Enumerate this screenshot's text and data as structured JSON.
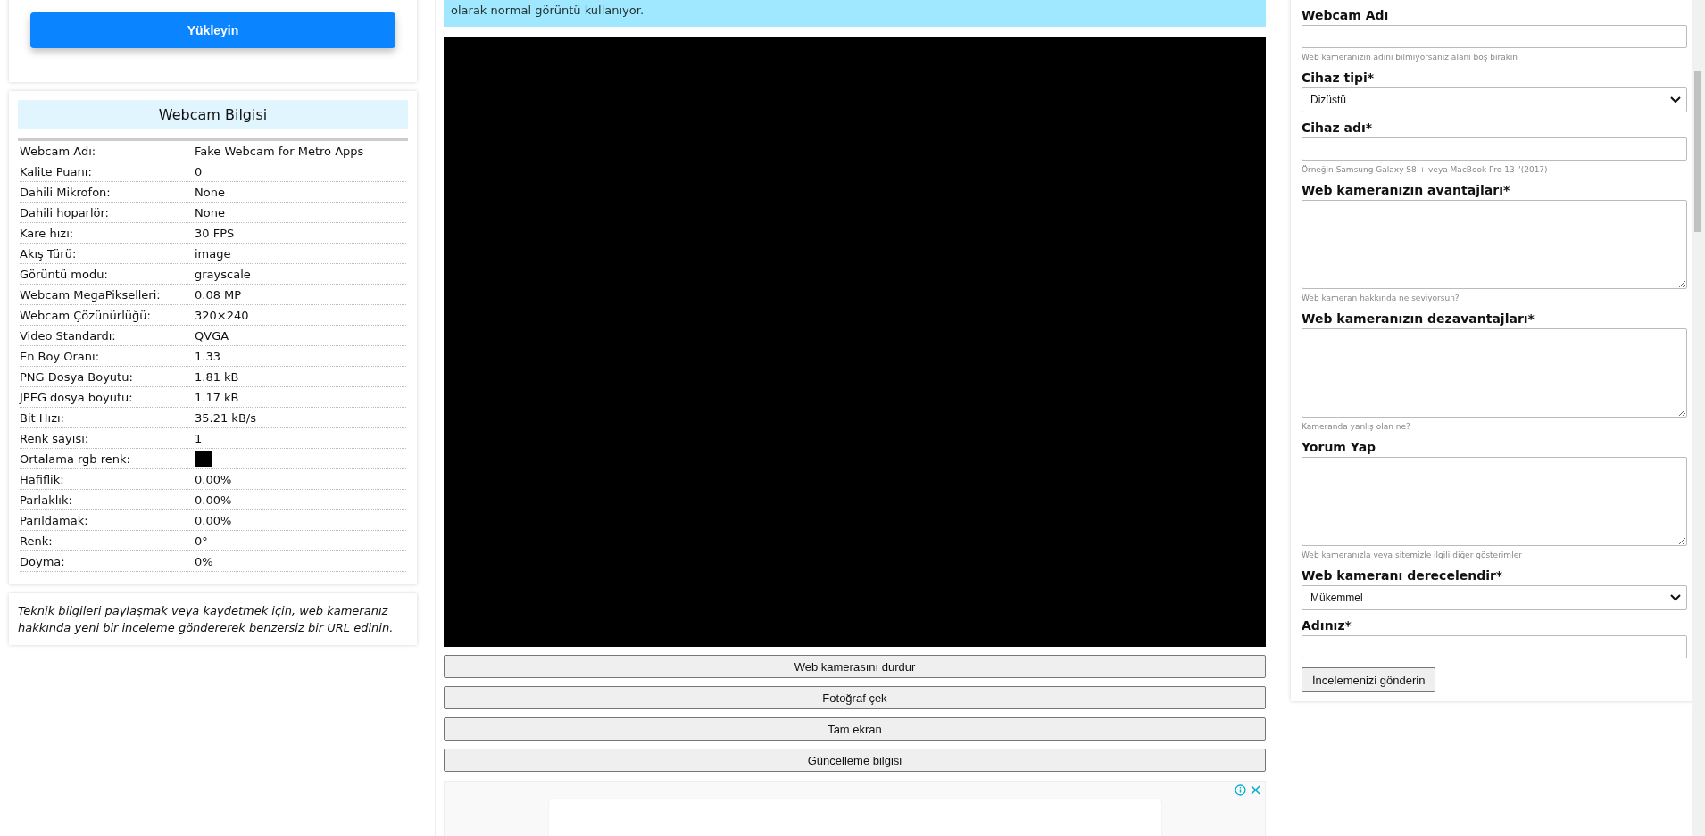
{
  "upload": {
    "button": "Yükleyin"
  },
  "info": {
    "title": "Webcam Bilgisi",
    "rows": [
      {
        "kind": "text",
        "label": "Webcam Adı:",
        "value": "Fake Webcam for Metro Apps"
      },
      {
        "kind": "text",
        "label": "Kalite Puanı:",
        "value": "0"
      },
      {
        "kind": "text",
        "label": "Dahili Mikrofon:",
        "value": "None"
      },
      {
        "kind": "text",
        "label": "Dahili hoparlör:",
        "value": "None"
      },
      {
        "kind": "text",
        "label": "Kare hızı:",
        "value": "30 FPS"
      },
      {
        "kind": "text",
        "label": "Akış Türü:",
        "value": "image"
      },
      {
        "kind": "text",
        "label": "Görüntü modu:",
        "value": "grayscale"
      },
      {
        "kind": "text",
        "label": "Webcam MegaPikselleri:",
        "value": "0.08 MP"
      },
      {
        "kind": "text",
        "label": "Webcam Çözünürlüğü:",
        "value": "320×240"
      },
      {
        "kind": "text",
        "label": "Video Standardı:",
        "value": "QVGA"
      },
      {
        "kind": "text",
        "label": "En Boy Oranı:",
        "value": "1.33"
      },
      {
        "kind": "text",
        "label": "PNG Dosya Boyutu:",
        "value": "1.81 kB"
      },
      {
        "kind": "text",
        "label": "JPEG dosya boyutu:",
        "value": "1.17 kB"
      },
      {
        "kind": "text",
        "label": "Bit Hızı:",
        "value": "35.21 kB/s"
      },
      {
        "kind": "text",
        "label": "Renk sayısı:",
        "value": "1"
      },
      {
        "kind": "swatch",
        "label": "Ortalama rgb renk:",
        "color": "#000000"
      },
      {
        "kind": "text",
        "label": "Hafiflik:",
        "value": "0.00%"
      },
      {
        "kind": "text",
        "label": "Parlaklık:",
        "value": "0.00%"
      },
      {
        "kind": "text",
        "label": "Parıldamak:",
        "value": "0.00%"
      },
      {
        "kind": "text",
        "label": "Renk:",
        "value": "0°"
      },
      {
        "kind": "text",
        "label": "Doyma:",
        "value": "0%"
      }
    ]
  },
  "note": "Teknik bilgileri paylaşmak veya kaydetmek için, web kameranız hakkında yeni bir inceleme göndererek benzersiz bir URL edinin.",
  "notice": "olarak normal görüntü kullanıyor.",
  "controls": [
    "Web kamerasını durdur",
    "Fotoğraf çek",
    "Tam ekran",
    "Güncelleme bilgisi"
  ],
  "form": {
    "fields": [
      {
        "kind": "input",
        "label": "Webcam Adı",
        "hint": "Web kameranızın adını bilmiyorsanız alanı boş bırakın"
      },
      {
        "kind": "select",
        "label": "Cihaz tipi*",
        "value": "Dizüstü"
      },
      {
        "kind": "input",
        "label": "Cihaz adı*",
        "hint": "Örneğin Samsung Galaxy S8 + veya MacBook Pro 13 \"(2017)"
      },
      {
        "kind": "textarea",
        "label": "Web kameranızın avantajları*",
        "hint": "Web kameran hakkında ne seviyorsun?"
      },
      {
        "kind": "textarea",
        "label": "Web kameranızın dezavantajları*",
        "hint": "Kameranda yanlış olan ne?"
      },
      {
        "kind": "textarea",
        "label": "Yorum Yap",
        "hint": "Web kameranızla veya sitemizle ilgili diğer gösterimler"
      },
      {
        "kind": "select",
        "label": "Web kameranı derecelendir*",
        "value": "Mükemmel"
      },
      {
        "kind": "input",
        "label": "Adınız*"
      }
    ],
    "submit": "İncelemenizi gönderin"
  }
}
